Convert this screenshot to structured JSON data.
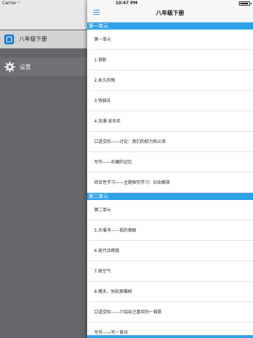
{
  "status_bar": {
    "carrier": "Carrier",
    "wifi_icon": "wifi-icon",
    "time": "10:47 PM",
    "battery_level": 0.95
  },
  "drawer": {
    "items": [
      {
        "label": "八年级下册",
        "icon": "book-app-icon"
      },
      {
        "label": "设置",
        "icon": "gear-icon"
      }
    ]
  },
  "nav": {
    "title": "八年级下册",
    "menu_icon": "hamburger-menu-icon"
  },
  "sections": [
    {
      "title": "第一单元",
      "rows": [
        "第一单元",
        "1.背影",
        "2.永久的悔",
        "3.铁骑兵",
        "4.苏珊·安东尼",
        "口语交际——讨论：我们的权力和义务",
        "写作——珍藏的记忆",
        "综合性学习——主题探究学习：妇女解放"
      ]
    },
    {
      "title": "第二单元",
      "rows": [
        "第二单元",
        "5.大堰河——我的保姆",
        "6.现代诗两首",
        "7.致空气",
        "8.槐夫，别砍那棵树",
        "口语交际——介绍自己喜欢的一首歌",
        "写作——写一首诗"
      ]
    }
  ],
  "colors": {
    "accent": "#2ea3ea",
    "drawer_bg": "#64666a",
    "selected_bg": "#d3d3d5"
  }
}
